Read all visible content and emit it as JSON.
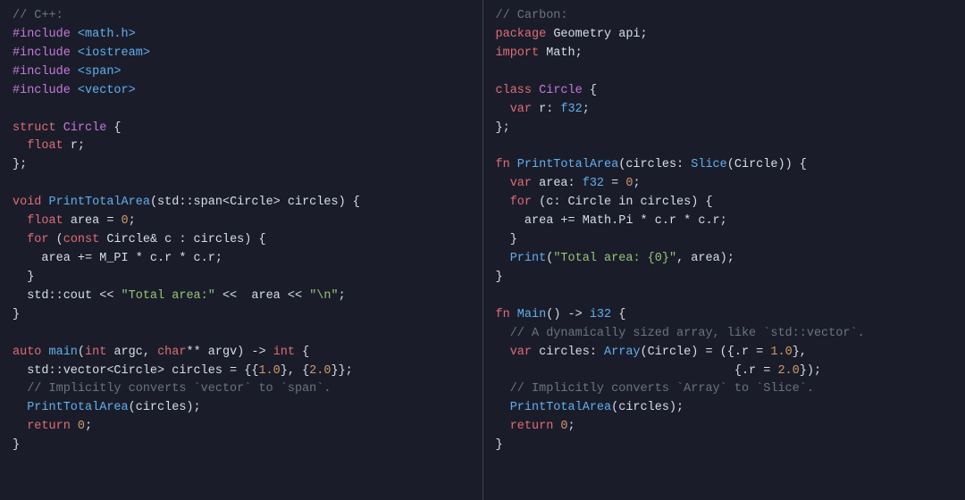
{
  "left": {
    "title_comment": "// C++:",
    "inc1_a": "#include",
    "inc1_b": " <math.h>",
    "inc2_a": "#include",
    "inc2_b": " <iostream>",
    "inc3_a": "#include",
    "inc3_b": " <span>",
    "inc4_a": "#include",
    "inc4_b": " <vector>",
    "struct_kw": "struct",
    "struct_name": " Circle",
    "struct_brace": " {",
    "field_type": "  float",
    "field_name": " r;",
    "struct_close": "};",
    "fn1_ret": "void",
    "fn1_name": " PrintTotalArea",
    "fn1_sig_a": "(std::span<",
    "fn1_sig_b": "Circle",
    "fn1_sig_c": "> circles) {",
    "area_a": "  float",
    "area_b": " area = ",
    "area_c": "0",
    "area_d": ";",
    "for_a": "  for",
    "for_b": " (",
    "for_c": "const",
    "for_d": " Circle",
    "for_e": "& c : circles) {",
    "loop_a": "    area += M_PI * c.r * c.r;",
    "loop_close": "  }",
    "cout_a": "  std::cout << ",
    "cout_b": "\"Total area:\"",
    "cout_c": " <<  area << ",
    "cout_d": "\"\\n\"",
    "cout_e": ";",
    "fn1_close": "}",
    "main_a": "auto",
    "main_b": " main",
    "main_c": "(",
    "main_d": "int",
    "main_e": " argc, ",
    "main_f": "char",
    "main_g": "** argv) -> ",
    "main_h": "int",
    "main_i": " {",
    "vec_a": "  std::vector<",
    "vec_b": "Circle",
    "vec_c": "> circles = {{",
    "vec_d": "1.0",
    "vec_e": "}, {",
    "vec_f": "2.0",
    "vec_g": "}};",
    "impl_comment": "  // Implicitly converts `vector` to `span`.",
    "call_a": "  PrintTotalArea",
    "call_b": "(circles);",
    "ret_a": "  return",
    "ret_b": " 0",
    "ret_c": ";",
    "main_close": "}"
  },
  "right": {
    "title_comment": "// Carbon:",
    "pkg_a": "package",
    "pkg_b": " Geometry api;",
    "imp_a": "import",
    "imp_b": " Math;",
    "class_a": "class",
    "class_b": " Circle",
    "class_c": " {",
    "var_a": "  var",
    "var_b": " r: ",
    "var_c": "f32",
    "var_d": ";",
    "class_close": "};",
    "fn1_a": "fn",
    "fn1_b": " PrintTotalArea",
    "fn1_c": "(circles: ",
    "fn1_d": "Slice",
    "fn1_e": "(Circle)) {",
    "area_a": "  var",
    "area_b": " area: ",
    "area_c": "f32",
    "area_d": " = ",
    "area_e": "0",
    "area_f": ";",
    "for_a": "  for",
    "for_b": " (c: ",
    "for_c": "Circle",
    "for_d": " in circles) {",
    "loop_a": "    area += Math.Pi * c.r * c.r;",
    "loop_close": "  }",
    "print_a": "  Print",
    "print_b": "(",
    "print_c": "\"Total area: {0}\"",
    "print_d": ", area);",
    "fn1_close": "}",
    "main_a": "fn",
    "main_b": " Main",
    "main_c": "() -> ",
    "main_d": "i32",
    "main_e": " {",
    "cmt1": "  // A dynamically sized array, like `std::vector`.",
    "circ_a": "  var",
    "circ_b": " circles: ",
    "circ_c": "Array",
    "circ_d": "(Circle) = ({.r = ",
    "circ_e": "1.0",
    "circ_f": "},",
    "circ2_a": "                                 {.r = ",
    "circ2_b": "2.0",
    "circ2_c": "});",
    "cmt2": "  // Implicitly converts `Array` to `Slice`.",
    "call_a": "  PrintTotalArea",
    "call_b": "(circles);",
    "ret_a": "  return",
    "ret_b": " 0",
    "ret_c": ";",
    "main_close": "}"
  }
}
